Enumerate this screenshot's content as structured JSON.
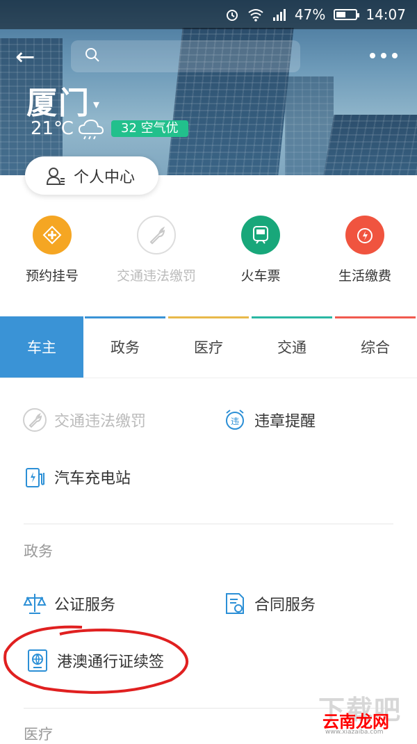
{
  "status_bar": {
    "battery": "47%",
    "time": "14:07",
    "icons": [
      "alarm-icon",
      "wifi-icon",
      "signal-icon",
      "battery-icon"
    ]
  },
  "header": {
    "back_icon": "back-arrow-icon",
    "search_icon": "search-icon",
    "more_icon": "more-icon",
    "city": "厦门",
    "temperature": "21℃",
    "air_quality": "32 空气优",
    "profile_button": "个人中心"
  },
  "quick_actions": [
    {
      "label": "预约挂号",
      "color": "#f5a623",
      "icon": "medical-cross-icon"
    },
    {
      "label": "交通违法缴罚",
      "color": "#ffffff",
      "icon": "wrench-icon",
      "disabled": true
    },
    {
      "label": "火车票",
      "color": "#18a77a",
      "icon": "train-icon"
    },
    {
      "label": "生活缴费",
      "color": "#f0543f",
      "icon": "energy-icon"
    }
  ],
  "tabs": [
    {
      "label": "车主",
      "active": true,
      "color": "#3a93d6"
    },
    {
      "label": "政务",
      "active": false,
      "color": "#3a93d6"
    },
    {
      "label": "医疗",
      "active": false,
      "color": "#e8b94a"
    },
    {
      "label": "交通",
      "active": false,
      "color": "#2ab7a3"
    },
    {
      "label": "综合",
      "active": false,
      "color": "#f05a4f"
    }
  ],
  "car_owner": {
    "items": [
      {
        "label": "交通违法缴罚",
        "icon": "wrench-icon",
        "disabled": true
      },
      {
        "label": "违章提醒",
        "icon": "alarm-clock-icon"
      },
      {
        "label": "汽车充电站",
        "icon": "charging-station-icon"
      }
    ]
  },
  "government": {
    "title": "政务",
    "items": [
      {
        "label": "公证服务",
        "icon": "scale-icon"
      },
      {
        "label": "合同服务",
        "icon": "contract-icon"
      },
      {
        "label": "港澳通行证续签",
        "icon": "passport-icon"
      }
    ]
  },
  "medical": {
    "title": "医疗"
  },
  "watermark": {
    "top": "下载吧",
    "middle": "云南龙网",
    "bottom": "www.xiazaiba.com"
  }
}
